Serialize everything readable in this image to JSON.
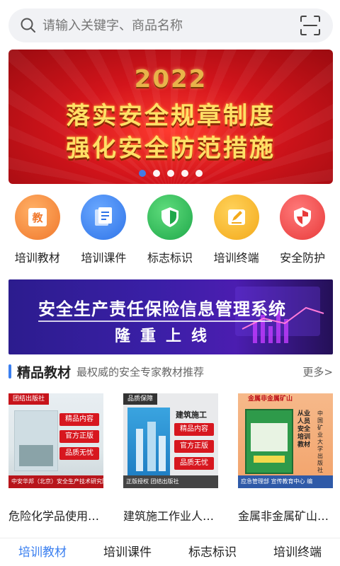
{
  "search": {
    "placeholder": "请输入关键字、商品名称"
  },
  "banner": {
    "year": "2022",
    "line1": "落实安全规章制度",
    "line2": "强化安全防范措施",
    "dots": 5,
    "active_dot": 1
  },
  "categories": [
    {
      "label": "培训教材",
      "icon": "textbook-icon",
      "color": "#f08a3c"
    },
    {
      "label": "培训课件",
      "icon": "courseware-icon",
      "color": "#3b82f0"
    },
    {
      "label": "标志标识",
      "icon": "shield-check-icon",
      "color": "#2db84d"
    },
    {
      "label": "培训终端",
      "icon": "terminal-edit-icon",
      "color": "#f5b324"
    },
    {
      "label": "安全防护",
      "icon": "shield-icon",
      "color": "#ef4b4b"
    }
  ],
  "banner2": {
    "title": "安全生产责任保险信息管理系统",
    "subtitle": "隆重上线"
  },
  "section": {
    "title": "精品教材",
    "subtitle": "最权威的安全专家教材推荐",
    "more": "更多>"
  },
  "books": [
    {
      "title": "危险化学品使用…",
      "tag": "团结出版社",
      "badges": [
        "精品内容",
        "官方正版",
        "品质无忧"
      ],
      "footer": "中安华邦（北京）安全生产技术研究院 编"
    },
    {
      "title": "建筑施工作业人…",
      "tag": "品质保障",
      "badges": [
        "精品内容",
        "官方正版",
        "品质无忧"
      ],
      "footer": "正版授权 团结出版社",
      "cover_heading": "建筑施工"
    },
    {
      "title": "金属非金属矿山…",
      "tag": "金属非金属矿山",
      "badges": [],
      "footer": "应急管理部 宣传教育中心 编",
      "cover_heading": "从业人员安全培训教材",
      "publisher": "中国矿业大学出版社"
    }
  ],
  "tabs": [
    {
      "label": "培训教材",
      "active": true
    },
    {
      "label": "培训课件",
      "active": false
    },
    {
      "label": "标志标识",
      "active": false
    },
    {
      "label": "培训终端",
      "active": false
    }
  ],
  "colors": {
    "accent": "#3a7ff0",
    "banner_red": "#d3141b",
    "banner_purple": "#3a1fa6"
  }
}
